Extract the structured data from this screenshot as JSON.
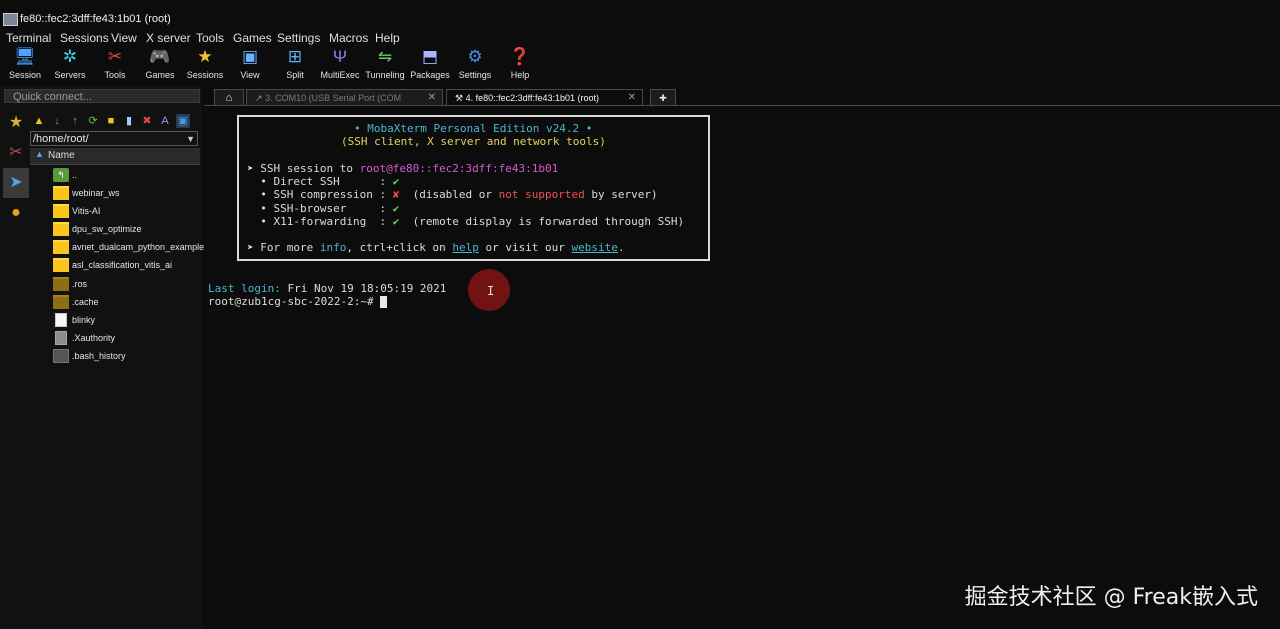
{
  "window": {
    "title": "fe80::fec2:3dff:fe43:1b01 (root)"
  },
  "menu": [
    "Terminal",
    "Sessions",
    "View",
    "X server",
    "Tools",
    "Games",
    "Settings",
    "Macros",
    "Help"
  ],
  "toolbar": [
    {
      "label": "Session",
      "icon": "session-icon"
    },
    {
      "label": "Servers",
      "icon": "servers-icon"
    },
    {
      "label": "Tools",
      "icon": "tools-icon"
    },
    {
      "label": "Games",
      "icon": "games-icon"
    },
    {
      "label": "Sessions",
      "icon": "star-icon"
    },
    {
      "label": "View",
      "icon": "view-icon"
    },
    {
      "label": "Split",
      "icon": "split-icon"
    },
    {
      "label": "MultiExec",
      "icon": "multiexec-icon"
    },
    {
      "label": "Tunneling",
      "icon": "tunneling-icon"
    },
    {
      "label": "Packages",
      "icon": "packages-icon"
    },
    {
      "label": "Settings",
      "icon": "gear-icon"
    },
    {
      "label": "Help",
      "icon": "help-icon"
    }
  ],
  "sidebar": {
    "quick_connect_placeholder": "Quick connect...",
    "path": "/home/root/",
    "header": "Name",
    "files": [
      {
        "name": "..",
        "type": "up"
      },
      {
        "name": "webinar_ws",
        "type": "folder"
      },
      {
        "name": "Vitis-AI",
        "type": "folder"
      },
      {
        "name": "dpu_sw_optimize",
        "type": "folder"
      },
      {
        "name": "avnet_dualcam_python_example",
        "type": "folder"
      },
      {
        "name": "asl_classification_vitis_ai",
        "type": "folder"
      },
      {
        "name": ".ros",
        "type": "folder-hidden"
      },
      {
        "name": ".cache",
        "type": "folder-hidden"
      },
      {
        "name": "blinky",
        "type": "file"
      },
      {
        "name": ".Xauthority",
        "type": "file-grey"
      },
      {
        "name": ".bash_history",
        "type": "file-dark"
      }
    ]
  },
  "tabs": [
    {
      "label": "3. COM10  (USB Serial Port (COM",
      "active": false
    },
    {
      "label": "4. fe80::fec2:3dff:fe43:1b01 (root)",
      "active": true
    }
  ],
  "terminal": {
    "banner_title": "• MobaXterm Personal Edition v24.2 •",
    "banner_subtitle": "(SSH client, X server and network tools)",
    "ssh_prefix": "➤ SSH session to ",
    "ssh_target": "root@fe80::fec2:3dff:fe43:1b01",
    "lines": [
      {
        "label": "  • Direct SSH      : ",
        "mark": "✔",
        "rest": ""
      },
      {
        "label": "  • SSH compression : ",
        "mark": "✘",
        "rest": ""
      },
      {
        "label": "  • SSH-browser     : ",
        "mark": "✔",
        "rest": ""
      },
      {
        "label": "  • X11-forwarding  : ",
        "mark": "✔",
        "rest": "  (remote display is forwarded through SSH)"
      }
    ],
    "compression_note_a": "  (disabled or ",
    "compression_note_b": "not supported",
    "compression_note_c": " by server)",
    "info_a": "➤ For more ",
    "info_link": "info",
    "info_b": ", ctrl+click on ",
    "help_link": "help",
    "info_c": " or visit our ",
    "website_link": "website",
    "info_d": ".",
    "last_login_label": "Last login:",
    "last_login_value": " Fri Nov 19 18:05:19 2021",
    "prompt": "root@zub1cg-sbc-2022-2:~# "
  },
  "watermark": "掘金技术社区 @ Freak嵌入式"
}
